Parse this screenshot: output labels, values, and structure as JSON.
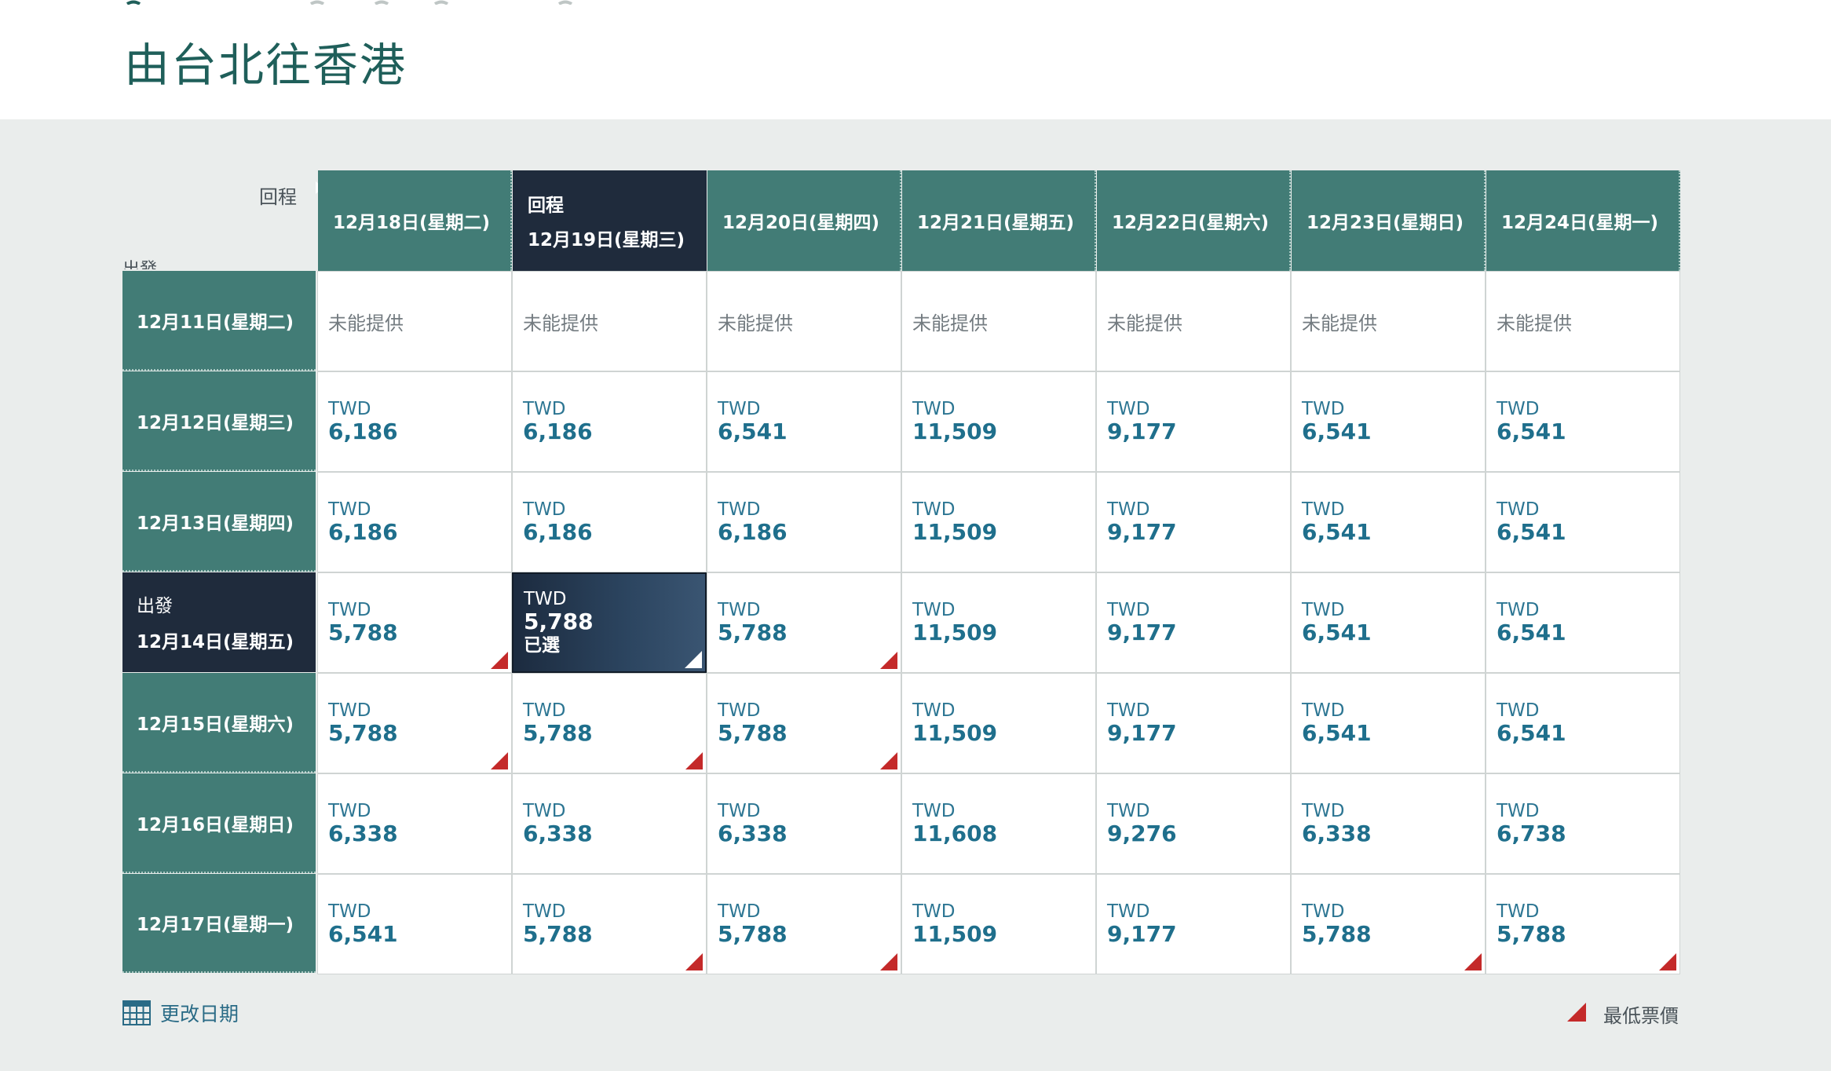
{
  "page": {
    "title": "由台北往香港"
  },
  "corner": {
    "return_label": "回程",
    "depart_label": "出發"
  },
  "colors": {
    "header_teal": "#427c76",
    "selected_navy": "#1f2b3c",
    "lowest_marker": "#c42a2a",
    "price_blue": "#1f6f8c"
  },
  "columns": [
    {
      "date": "12月18日(星期二)",
      "label": ""
    },
    {
      "date": "12月19日(星期三)",
      "label": "回程",
      "selected": true
    },
    {
      "date": "12月20日(星期四)",
      "label": ""
    },
    {
      "date": "12月21日(星期五)",
      "label": ""
    },
    {
      "date": "12月22日(星期六)",
      "label": ""
    },
    {
      "date": "12月23日(星期日)",
      "label": ""
    },
    {
      "date": "12月24日(星期一)",
      "label": ""
    }
  ],
  "rows": [
    {
      "date": "12月11日(星期二)",
      "label": "",
      "cells": [
        {
          "na": "未能提供"
        },
        {
          "na": "未能提供"
        },
        {
          "na": "未能提供"
        },
        {
          "na": "未能提供"
        },
        {
          "na": "未能提供"
        },
        {
          "na": "未能提供"
        },
        {
          "na": "未能提供"
        }
      ]
    },
    {
      "date": "12月12日(星期三)",
      "label": "",
      "cells": [
        {
          "currency": "TWD",
          "price": "6,186"
        },
        {
          "currency": "TWD",
          "price": "6,186"
        },
        {
          "currency": "TWD",
          "price": "6,541"
        },
        {
          "currency": "TWD",
          "price": "11,509"
        },
        {
          "currency": "TWD",
          "price": "9,177"
        },
        {
          "currency": "TWD",
          "price": "6,541"
        },
        {
          "currency": "TWD",
          "price": "6,541"
        }
      ]
    },
    {
      "date": "12月13日(星期四)",
      "label": "",
      "cells": [
        {
          "currency": "TWD",
          "price": "6,186"
        },
        {
          "currency": "TWD",
          "price": "6,186"
        },
        {
          "currency": "TWD",
          "price": "6,186"
        },
        {
          "currency": "TWD",
          "price": "11,509"
        },
        {
          "currency": "TWD",
          "price": "9,177"
        },
        {
          "currency": "TWD",
          "price": "6,541"
        },
        {
          "currency": "TWD",
          "price": "6,541"
        }
      ]
    },
    {
      "date": "12月14日(星期五)",
      "label": "出發",
      "selected": true,
      "cells": [
        {
          "currency": "TWD",
          "price": "5,788",
          "lowest": true
        },
        {
          "currency": "TWD",
          "price": "5,788",
          "selected": true,
          "sub": "已選",
          "lowest": true
        },
        {
          "currency": "TWD",
          "price": "5,788",
          "lowest": true
        },
        {
          "currency": "TWD",
          "price": "11,509"
        },
        {
          "currency": "TWD",
          "price": "9,177"
        },
        {
          "currency": "TWD",
          "price": "6,541"
        },
        {
          "currency": "TWD",
          "price": "6,541"
        }
      ]
    },
    {
      "date": "12月15日(星期六)",
      "label": "",
      "cells": [
        {
          "currency": "TWD",
          "price": "5,788",
          "lowest": true
        },
        {
          "currency": "TWD",
          "price": "5,788",
          "lowest": true
        },
        {
          "currency": "TWD",
          "price": "5,788",
          "lowest": true
        },
        {
          "currency": "TWD",
          "price": "11,509"
        },
        {
          "currency": "TWD",
          "price": "9,177"
        },
        {
          "currency": "TWD",
          "price": "6,541"
        },
        {
          "currency": "TWD",
          "price": "6,541"
        }
      ]
    },
    {
      "date": "12月16日(星期日)",
      "label": "",
      "cells": [
        {
          "currency": "TWD",
          "price": "6,338"
        },
        {
          "currency": "TWD",
          "price": "6,338"
        },
        {
          "currency": "TWD",
          "price": "6,338"
        },
        {
          "currency": "TWD",
          "price": "11,608"
        },
        {
          "currency": "TWD",
          "price": "9,276"
        },
        {
          "currency": "TWD",
          "price": "6,338"
        },
        {
          "currency": "TWD",
          "price": "6,738"
        }
      ]
    },
    {
      "date": "12月17日(星期一)",
      "label": "",
      "cells": [
        {
          "currency": "TWD",
          "price": "6,541"
        },
        {
          "currency": "TWD",
          "price": "5,788",
          "lowest": true
        },
        {
          "currency": "TWD",
          "price": "5,788",
          "lowest": true
        },
        {
          "currency": "TWD",
          "price": "11,509"
        },
        {
          "currency": "TWD",
          "price": "9,177"
        },
        {
          "currency": "TWD",
          "price": "5,788",
          "lowest": true
        },
        {
          "currency": "TWD",
          "price": "5,788",
          "lowest": true
        }
      ]
    }
  ],
  "footer": {
    "change_date": "更改日期",
    "legend_lowest": "最低票價",
    "calendar_icon": "calendar-icon"
  }
}
